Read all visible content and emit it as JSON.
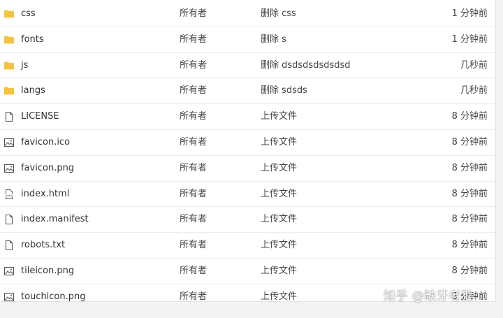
{
  "file_list": {
    "rows": [
      {
        "icon": "folder-icon",
        "name": "css",
        "owner": "所有者",
        "message": "删除 css",
        "time": "1 分钟前"
      },
      {
        "icon": "folder-icon",
        "name": "fonts",
        "owner": "所有者",
        "message": "删除 s",
        "time": "1 分钟前"
      },
      {
        "icon": "folder-icon",
        "name": "js",
        "owner": "所有者",
        "message": "删除 dsdsdsdsdsdsd",
        "time": "几秒前"
      },
      {
        "icon": "folder-icon",
        "name": "langs",
        "owner": "所有者",
        "message": "删除 sdsds",
        "time": "几秒前"
      },
      {
        "icon": "file-icon",
        "name": "LICENSE",
        "owner": "所有者",
        "message": "上传文件",
        "time": "8 分钟前"
      },
      {
        "icon": "image-file-icon",
        "name": "favicon.ico",
        "owner": "所有者",
        "message": "上传文件",
        "time": "8 分钟前"
      },
      {
        "icon": "image-file-icon",
        "name": "favicon.png",
        "owner": "所有者",
        "message": "上传文件",
        "time": "8 分钟前"
      },
      {
        "icon": "html-file-icon",
        "name": "index.html",
        "owner": "所有者",
        "message": "上传文件",
        "time": "8 分钟前"
      },
      {
        "icon": "file-icon",
        "name": "index.manifest",
        "owner": "所有者",
        "message": "上传文件",
        "time": "8 分钟前"
      },
      {
        "icon": "file-icon",
        "name": "robots.txt",
        "owner": "所有者",
        "message": "上传文件",
        "time": "8 分钟前"
      },
      {
        "icon": "image-file-icon",
        "name": "tileicon.png",
        "owner": "所有者",
        "message": "上传文件",
        "time": "8 分钟前"
      },
      {
        "icon": "image-file-icon",
        "name": "touchicon.png",
        "owner": "所有者",
        "message": "上传文件",
        "time": "8 分钟前"
      }
    ]
  },
  "watermark": {
    "text": "知乎 @缺牙老狼"
  },
  "colors": {
    "folder": "#f5c342",
    "icon_stroke": "#555555"
  }
}
